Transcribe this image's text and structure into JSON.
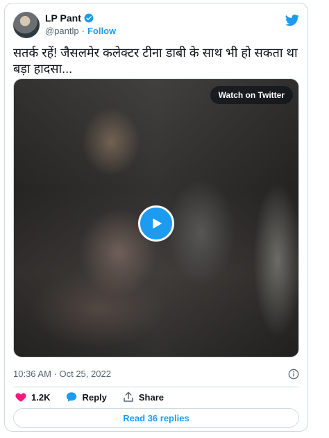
{
  "author": {
    "name": "LP Pant",
    "handle": "@pantlp",
    "separator": "·",
    "follow_label": "Follow"
  },
  "tweet": {
    "text": "सतर्क रहें! जैसलमेर कलेक्टर टीना डाबी के साथ भी हो सकता था बड़ा हादसा..."
  },
  "media": {
    "watch_label": "Watch on Twitter"
  },
  "meta": {
    "timestamp": "10:36 AM · Oct 25, 2022"
  },
  "actions": {
    "like_count": "1.2K",
    "reply_label": "Reply",
    "share_label": "Share"
  },
  "footer": {
    "read_replies_label": "Read 36 replies"
  },
  "colors": {
    "accent": "#1d9bf0",
    "like": "#f91880",
    "muted": "#536471",
    "border": "#cfd9de"
  },
  "icons": [
    "verified-badge-icon",
    "twitter-bird-icon",
    "play-icon",
    "info-icon",
    "heart-icon",
    "reply-bubble-icon",
    "share-icon"
  ]
}
